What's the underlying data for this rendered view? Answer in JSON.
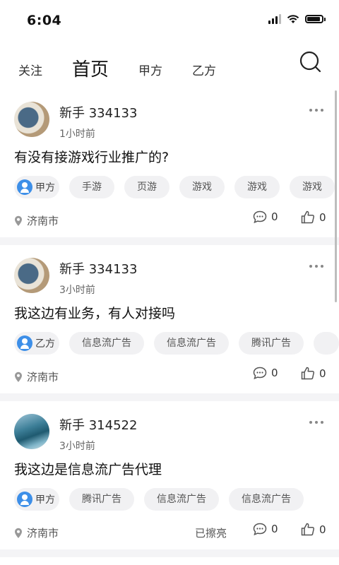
{
  "status_bar": {
    "time": "6:04"
  },
  "nav": {
    "tabs": [
      {
        "label": "关注",
        "active": false
      },
      {
        "label": "首页",
        "active": true
      },
      {
        "label": "甲方",
        "active": false
      },
      {
        "label": "乙方",
        "active": false
      }
    ],
    "search_icon": "search-icon"
  },
  "posts": [
    {
      "username": "新手 334133",
      "time_ago": "1小时前",
      "text": "有没有接游戏行业推广的?",
      "role": "甲方",
      "tags": [
        "手游",
        "页游",
        "游戏",
        "游戏",
        "游戏"
      ],
      "location": "济南市",
      "polished": "",
      "comments": "0",
      "likes": "0",
      "avatar": "coffee-cup-avatar"
    },
    {
      "username": "新手 334133",
      "time_ago": "3小时前",
      "text": "我这边有业务，有人对接吗",
      "role": "乙方",
      "tags": [
        "信息流广告",
        "信息流广告",
        "腾讯广告"
      ],
      "location": "济南市",
      "polished": "",
      "comments": "0",
      "likes": "0",
      "avatar": "coffee-cup-avatar"
    },
    {
      "username": "新手 314522",
      "time_ago": "3小时前",
      "text": "我这边是信息流广告代理",
      "role": "甲方",
      "tags": [
        "腾讯广告",
        "信息流广告",
        "信息流广告"
      ],
      "location": "济南市",
      "polished": "已擦亮",
      "comments": "0",
      "likes": "0",
      "avatar": "ocean-wave-avatar"
    }
  ],
  "colors": {
    "role_icon": "#3d8fe8",
    "tag_bg": "#f1f1f3",
    "feed_gap": "#f4f4f6"
  }
}
